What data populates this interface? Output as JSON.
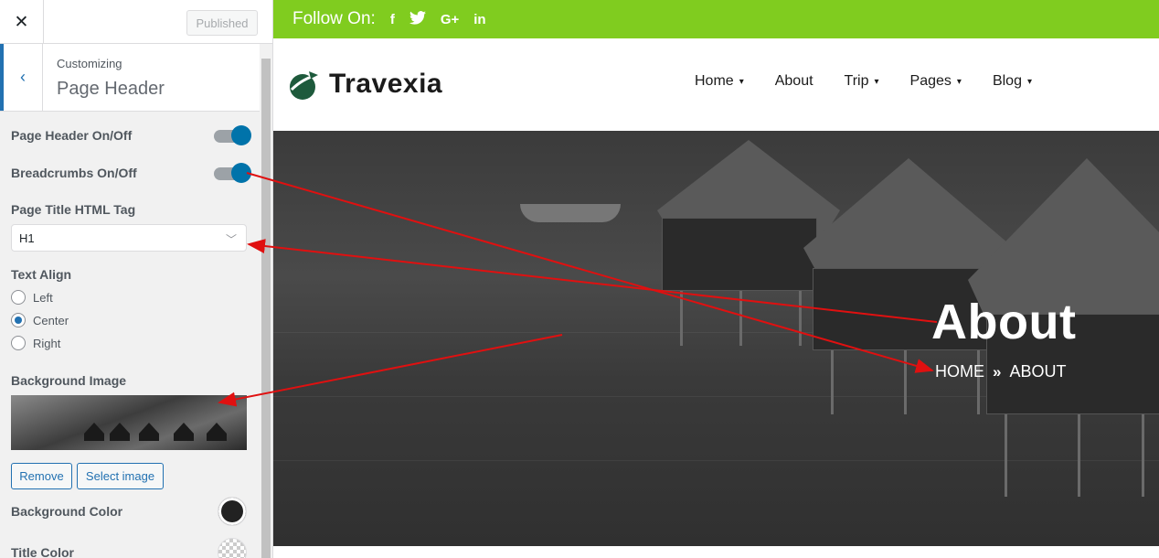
{
  "panel": {
    "close_label": "✕",
    "published_label": "Published",
    "back_label": "‹",
    "customizing_label": "Customizing",
    "section_title": "Page Header",
    "controls": {
      "page_header_toggle_label": "Page Header On/Off",
      "page_header_toggle_on": true,
      "breadcrumbs_toggle_label": "Breadcrumbs On/Off",
      "breadcrumbs_toggle_on": true,
      "title_tag_label": "Page Title HTML Tag",
      "title_tag_value": "H1",
      "text_align_label": "Text Align",
      "text_align_options": [
        "Left",
        "Center",
        "Right"
      ],
      "text_align_selected": "Center",
      "bg_image_label": "Background Image",
      "remove_label": "Remove",
      "select_image_label": "Select image",
      "bg_color_label": "Background Color",
      "bg_color_value": "#222222",
      "title_color_label": "Title Color"
    }
  },
  "preview": {
    "follow_label": "Follow On:",
    "social_icons": [
      "facebook-icon",
      "twitter-icon",
      "google-plus-icon",
      "linkedin-icon"
    ],
    "social_glyphs": [
      "f",
      "🐦",
      "G+",
      "in"
    ],
    "brand": "Travexia",
    "nav": [
      {
        "label": "Home",
        "has_dropdown": true
      },
      {
        "label": "About",
        "has_dropdown": false
      },
      {
        "label": "Trip",
        "has_dropdown": true
      },
      {
        "label": "Pages",
        "has_dropdown": true
      },
      {
        "label": "Blog",
        "has_dropdown": true
      }
    ],
    "hero_title": "About",
    "breadcrumb_home": "HOME",
    "breadcrumb_sep": "»",
    "breadcrumb_current": "ABOUT"
  },
  "colors": {
    "accent_green": "#80cc1f",
    "toggle_blue": "#0073aa",
    "annotation_red": "#e01010"
  }
}
